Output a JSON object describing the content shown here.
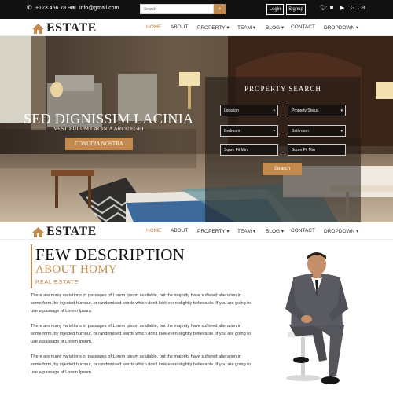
{
  "topbar": {
    "phone": "+123 456 78 90",
    "email": "info@gmail.com",
    "search_placeholder": "Search",
    "login": "Login",
    "signup": "Signup",
    "social_icons": [
      "twitter-icon",
      "instagram-icon",
      "youtube-icon",
      "google-icon",
      "settings-icon"
    ]
  },
  "logo": {
    "text": "ESTATE",
    "icon": "house-icon"
  },
  "nav": {
    "items": [
      "HOME",
      "ABOUT",
      "PROPERTY ▾",
      "TEAM ▾",
      "BLOG ▾",
      "CONTACT",
      "DROPDOWN ▾"
    ],
    "active": "HOME"
  },
  "hero": {
    "title": "SED DIGNISSIM LACINIA",
    "subtitle": "VESTIBULUM LACINIA ARCU EGET",
    "button": "CONUDIA NOSTRA"
  },
  "property_search": {
    "title": "PROPERTY SEARCH",
    "fields": [
      "Location",
      "Property Status",
      "Bedroom",
      "Bathroom",
      "Squre Fit Min",
      "Squre Fit Min"
    ],
    "button": "Search"
  },
  "description": {
    "title": "FEW DESCRIPTION",
    "subtitle": "ABOUT HOMY",
    "label": "REAL ESTATE",
    "paragraphs": [
      "There are many variations of passages of Lorem Ipsum available, but the majority have suffered alteration in some form, by injected humour, or randomised words which don't look even slightly believable. If you are going to use a passage of Lorem Ipsum.",
      "There are many variations of passages of Lorem Ipsum available, but the majority have suffered alteration in some form, by injected humour, or randomised words which don't look even slightly believable. If you are going to use a passage of Lorem Ipsum.",
      "There are many variations of passages of Lorem Ipsum available, but the majority have suffered alteration in some form, by injected humour, or randomised words which don't look even slightly believable. If you are going to use a passage of Lorem Ipsum."
    ]
  },
  "colors": {
    "accent": "#c48a4d",
    "topbar": "#111111",
    "text": "#333333"
  }
}
